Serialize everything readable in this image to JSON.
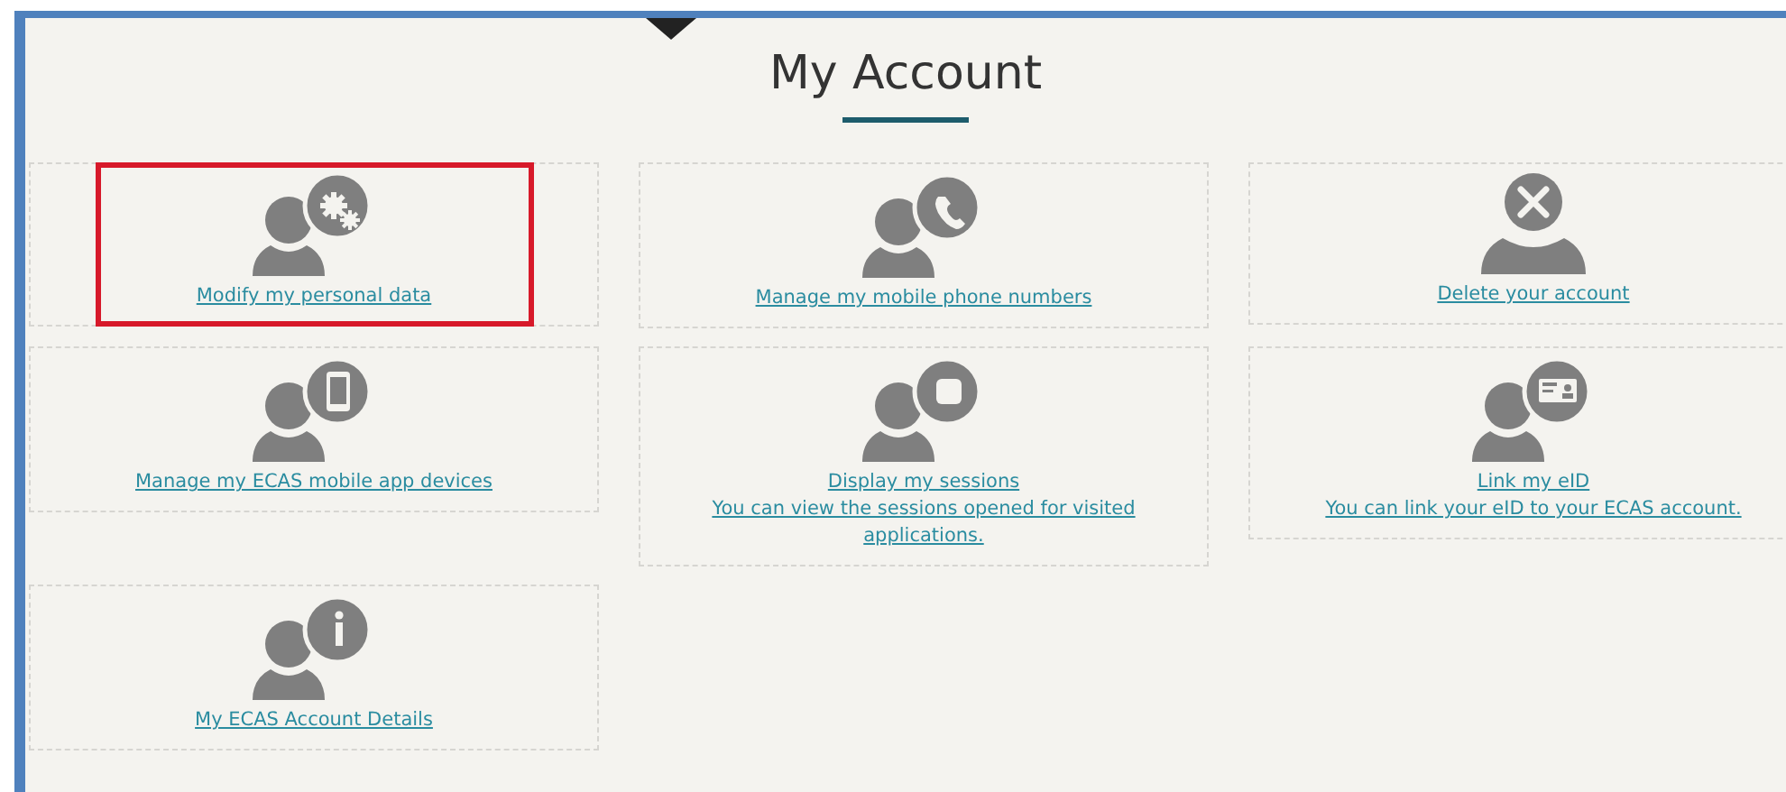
{
  "title": "My Account",
  "cards": [
    {
      "kind": "gears",
      "label": "Modify my personal data",
      "highlighted": true
    },
    {
      "kind": "phone",
      "label": "Manage my mobile phone numbers",
      "highlighted": false
    },
    {
      "kind": "delete",
      "label": "Delete your account",
      "highlighted": false
    },
    {
      "kind": "tablet",
      "label": "Manage my ECAS mobile app devices",
      "highlighted": false
    },
    {
      "kind": "session",
      "label": "Display my sessions",
      "description": "You can view the sessions opened for visited applications.",
      "highlighted": false
    },
    {
      "kind": "eid",
      "label": "Link my eID",
      "description": "You can link your eID to your ECAS account.",
      "highlighted": false
    },
    {
      "kind": "info",
      "label": "My ECAS Account Details",
      "highlighted": false
    }
  ]
}
